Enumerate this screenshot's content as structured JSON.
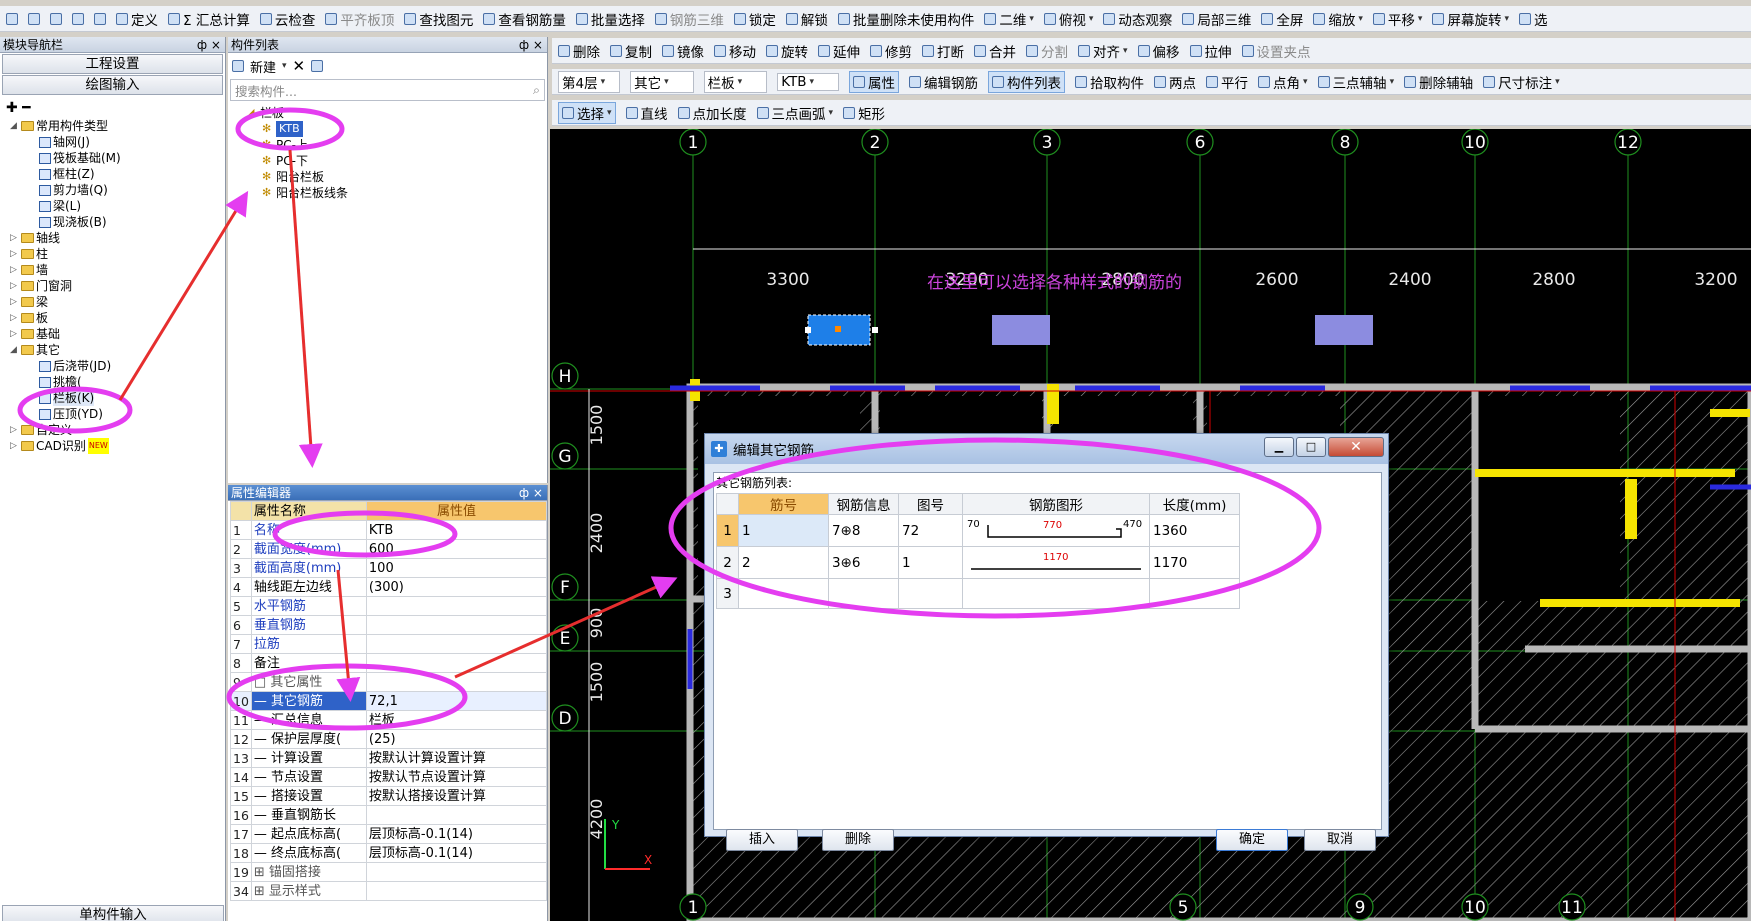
{
  "toolbar1": {
    "items": [
      {
        "name": "new-file-icon",
        "label": "",
        "icon": "page-icon"
      },
      {
        "name": "open-file-icon",
        "label": "",
        "icon": "folder-icon"
      },
      {
        "name": "save-icon",
        "label": "",
        "icon": "floppy-icon"
      },
      {
        "name": "undo-icon",
        "label": "",
        "icon": "undo-icon"
      },
      {
        "name": "redo-icon",
        "label": "",
        "icon": "redo-icon"
      },
      {
        "name": "define-button",
        "label": "定义"
      },
      {
        "name": "sum-calc-button",
        "label": "Σ 汇总计算"
      },
      {
        "name": "cloud-check-button",
        "label": "云检查"
      },
      {
        "name": "align-slab-top-button",
        "label": "平齐板顶",
        "grayed": true
      },
      {
        "name": "find-element-button",
        "label": "查找图元"
      },
      {
        "name": "view-rebar-button",
        "label": "查看钢筋量"
      },
      {
        "name": "batch-select-button",
        "label": "批量选择"
      },
      {
        "name": "rebar-3d-button",
        "label": "钢筋三维",
        "grayed": true
      },
      {
        "name": "lock-button",
        "label": "锁定"
      },
      {
        "name": "unlock-button",
        "label": "解锁"
      },
      {
        "name": "batch-delete-unused-button",
        "label": "批量删除未使用构件"
      },
      {
        "name": "view-2d-button",
        "label": "二维",
        "dropdown": true
      },
      {
        "name": "top-view-button",
        "label": "俯视",
        "dropdown": true
      },
      {
        "name": "dynamic-observe-button",
        "label": "动态观察"
      },
      {
        "name": "local-3d-button",
        "label": "局部三维"
      },
      {
        "name": "fullscreen-button",
        "label": "全屏"
      },
      {
        "name": "zoom-button",
        "label": "缩放",
        "dropdown": true
      },
      {
        "name": "pan-button",
        "label": "平移",
        "dropdown": true
      },
      {
        "name": "screen-rotate-button",
        "label": "屏幕旋转",
        "dropdown": true
      },
      {
        "name": "select-more-button",
        "label": "选"
      }
    ]
  },
  "toolbar2": {
    "items": [
      {
        "name": "delete-button",
        "label": "删除"
      },
      {
        "name": "copy-button",
        "label": "复制"
      },
      {
        "name": "mirror-button",
        "label": "镜像"
      },
      {
        "name": "move-button",
        "label": "移动"
      },
      {
        "name": "rotate-button",
        "label": "旋转"
      },
      {
        "name": "extend-button",
        "label": "延伸"
      },
      {
        "name": "trim-button",
        "label": "修剪"
      },
      {
        "name": "break-button",
        "label": "打断"
      },
      {
        "name": "merge-button",
        "label": "合并"
      },
      {
        "name": "split-button",
        "label": "分割",
        "grayed": true
      },
      {
        "name": "align-button",
        "label": "对齐",
        "dropdown": true
      },
      {
        "name": "offset-button",
        "label": "偏移"
      },
      {
        "name": "stretch-button",
        "label": "拉伸"
      },
      {
        "name": "set-grip-button",
        "label": "设置夹点",
        "grayed": true
      }
    ]
  },
  "toolbar3": {
    "floor": "第4层",
    "category": "其它",
    "type": "栏板",
    "component": "KTB",
    "items": [
      {
        "name": "attribute-button",
        "label": "属性",
        "active": true
      },
      {
        "name": "edit-rebar-button",
        "label": "编辑钢筋"
      },
      {
        "name": "component-list-button",
        "label": "构件列表",
        "active": true
      },
      {
        "name": "pick-component-button",
        "label": "拾取构件"
      },
      {
        "name": "two-point-button",
        "label": "两点"
      },
      {
        "name": "parallel-button",
        "label": "平行"
      },
      {
        "name": "point-angle-button",
        "label": "点角",
        "dropdown": true
      },
      {
        "name": "three-point-aux-button",
        "label": "三点辅轴",
        "dropdown": true
      },
      {
        "name": "delete-aux-button",
        "label": "删除辅轴"
      },
      {
        "name": "dimension-button",
        "label": "尺寸标注",
        "dropdown": true
      }
    ]
  },
  "toolbar4": {
    "items": [
      {
        "name": "select-button",
        "label": "选择",
        "dropdown": true,
        "active": true
      },
      {
        "name": "line-button",
        "label": "直线"
      },
      {
        "name": "point-length-button",
        "label": "点加长度"
      },
      {
        "name": "three-point-arc-button",
        "label": "三点画弧",
        "dropdown": true
      },
      {
        "name": "rect-button",
        "label": "矩形"
      }
    ]
  },
  "nav": {
    "title": "模块导航栏",
    "pin": "ф ×",
    "btn1": "工程设置",
    "btn2": "绘图输入",
    "bottom": "单构件输入",
    "tree": [
      {
        "label": "常用构件类型",
        "level": 0,
        "folder": true,
        "open": true
      },
      {
        "label": "轴网(J)",
        "level": 1
      },
      {
        "label": "筏板基础(M)",
        "level": 1
      },
      {
        "label": "框柱(Z)",
        "level": 1
      },
      {
        "label": "剪力墙(Q)",
        "level": 1
      },
      {
        "label": "梁(L)",
        "level": 1
      },
      {
        "label": "现浇板(B)",
        "level": 1
      },
      {
        "label": "轴线",
        "level": 0,
        "folder": true
      },
      {
        "label": "柱",
        "level": 0,
        "folder": true
      },
      {
        "label": "墙",
        "level": 0,
        "folder": true
      },
      {
        "label": "门窗洞",
        "level": 0,
        "folder": true
      },
      {
        "label": "梁",
        "level": 0,
        "folder": true
      },
      {
        "label": "板",
        "level": 0,
        "folder": true
      },
      {
        "label": "基础",
        "level": 0,
        "folder": true
      },
      {
        "label": "其它",
        "level": 0,
        "folder": true,
        "open": true
      },
      {
        "label": "后浇带(JD)",
        "level": 1
      },
      {
        "label": "挑檐(",
        "level": 1
      },
      {
        "label": "栏板(K)",
        "level": 1,
        "selected": true
      },
      {
        "label": "压顶(YD)",
        "level": 1
      },
      {
        "label": "自定义",
        "level": 0,
        "folder": true
      },
      {
        "label": "CAD识别",
        "level": 0,
        "folder": true,
        "badge": "NEW"
      }
    ]
  },
  "comp": {
    "title": "构件列表",
    "pin": "ф ×",
    "new_label": "新建",
    "search_placeholder": "搜索构件...",
    "tree": [
      {
        "label": "栏板",
        "level": 0
      },
      {
        "label": "KTB",
        "level": 1,
        "selected": true
      },
      {
        "label": "PC-上",
        "level": 1
      },
      {
        "label": "PC-下",
        "level": 1
      },
      {
        "label": "阳台栏板",
        "level": 1
      },
      {
        "label": "阳台栏板线条",
        "level": 1
      }
    ]
  },
  "props": {
    "title": "属性编辑器",
    "pin": "ф ×",
    "col_name": "属性名称",
    "col_value": "属性值",
    "rows": [
      {
        "n": "1",
        "k": "名称",
        "v": "KTB",
        "blue": true
      },
      {
        "n": "2",
        "k": "截面宽度(mm)",
        "v": "600",
        "blue": true
      },
      {
        "n": "3",
        "k": "截面高度(mm)",
        "v": "100",
        "blue": true
      },
      {
        "n": "4",
        "k": "轴线距左边线",
        "v": "(300)"
      },
      {
        "n": "5",
        "k": "水平钢筋",
        "v": "",
        "blue": true
      },
      {
        "n": "6",
        "k": "垂直钢筋",
        "v": "",
        "blue": true
      },
      {
        "n": "7",
        "k": "拉筋",
        "v": "",
        "blue": true
      },
      {
        "n": "8",
        "k": "备注",
        "v": ""
      },
      {
        "n": "9",
        "k": "□ 其它属性",
        "v": "",
        "gray": true
      },
      {
        "n": "10",
        "k": "— 其它钢筋",
        "v": "72,1",
        "selected": true
      },
      {
        "n": "11",
        "k": "— 汇总信息",
        "v": "栏板"
      },
      {
        "n": "12",
        "k": "— 保护层厚度(",
        "v": "(25)"
      },
      {
        "n": "13",
        "k": "— 计算设置",
        "v": "按默认计算设置计算"
      },
      {
        "n": "14",
        "k": "— 节点设置",
        "v": "按默认节点设置计算"
      },
      {
        "n": "15",
        "k": "— 搭接设置",
        "v": "按默认搭接设置计算"
      },
      {
        "n": "16",
        "k": "— 垂直钢筋长",
        "v": ""
      },
      {
        "n": "17",
        "k": "— 起点底标高(",
        "v": "层顶标高-0.1(14)"
      },
      {
        "n": "18",
        "k": "— 终点底标高(",
        "v": "层顶标高-0.1(14)"
      },
      {
        "n": "19",
        "k": "⊞ 锚固搭接",
        "v": "",
        "gray": true
      },
      {
        "n": "34",
        "k": "⊞ 显示样式",
        "v": "",
        "gray": true
      }
    ]
  },
  "canvas": {
    "note": "在这里可以选择各种样式的钢筋的",
    "top_axes": [
      "1",
      "2",
      "3",
      "6",
      "8",
      "10",
      "12"
    ],
    "spans": [
      "3300",
      "3200",
      "2800",
      "2600",
      "2400",
      "2800",
      "3200"
    ],
    "left_axes": [
      "H",
      "G",
      "F",
      "E",
      "D"
    ],
    "left_dims": [
      "1500",
      "2400",
      "900",
      "1500",
      "4200"
    ],
    "bottom_axes": [
      "1",
      "5",
      "9",
      "10",
      "11"
    ],
    "ucs_x": "X",
    "ucs_y": "Y",
    "colors": {
      "grid": "#1f8f1f",
      "wall": "#b8b8b8",
      "yellow": "#f5e400",
      "red": "#d40000",
      "blue": "#2a2adf",
      "highlight": "#1e7fe8",
      "magenta": "#cc44dd"
    }
  },
  "dialog": {
    "title": "编辑其它钢筋",
    "list_label": "其它钢筋列表:",
    "headers": [
      "筋号",
      "钢筋信息",
      "图号",
      "钢筋图形",
      "长度(mm)"
    ],
    "rows": [
      {
        "idx": "1",
        "no": "1",
        "info": "7⊕8",
        "fig": "72",
        "shape_left": "70",
        "shape_mid": "770",
        "shape_right": "470",
        "len": "1360"
      },
      {
        "idx": "2",
        "no": "2",
        "info": "3⊕6",
        "fig": "1",
        "shape_left": "",
        "shape_mid": "1170",
        "shape_right": "",
        "len": "1170"
      },
      {
        "idx": "3",
        "no": "",
        "info": "",
        "fig": "",
        "shape_left": "",
        "shape_mid": "",
        "shape_right": "",
        "len": ""
      }
    ],
    "insert": "插入",
    "delete": "删除",
    "ok": "确定",
    "cancel": "取消"
  },
  "annotation_color": "#e43df0"
}
